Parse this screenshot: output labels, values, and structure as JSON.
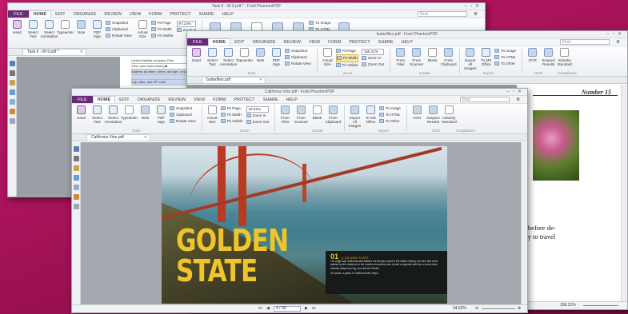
{
  "win1": {
    "title": "Task 6 - W-9.pdf * - Foxit PhantomPDF",
    "menu": [
      "FILE",
      "HOME",
      "EDIT",
      "ORGANIZE",
      "REVIEW",
      "VIEW",
      "FORM",
      "PROTECT",
      "SHARE",
      "HELP"
    ],
    "search_placeholder": "Find",
    "tools": [
      "Hand",
      "Select Text",
      "Select Annotation",
      "Typewriter",
      "Note",
      "PDF Sign",
      "Actual Size"
    ],
    "small1": [
      "SnapShot",
      "Clipboard",
      "Rotate View"
    ],
    "small2": [
      "Fit Page",
      "Fit Width",
      "Fit Visible"
    ],
    "zoom": "97.24%",
    "zoom_items": [
      "Zoom In",
      "Zoom Out"
    ],
    "small3": [
      "To Image",
      "To HTML"
    ],
    "group_tools": "Tools",
    "tab": "Task 6 - W-9.pdf *",
    "form_lines": [
      "Limited liability company. Ente",
      "Other (see instructions) ▶",
      "Address (number, street, and apt. or suite no.)",
      "City, state, and ZIP code"
    ]
  },
  "win2": {
    "title": "butterflies.pdf - Foxit PhantomPDF",
    "menu": [
      "FILE",
      "HOME",
      "EDIT",
      "ORGANIZE",
      "REVIEW",
      "VIEW",
      "FORM",
      "PROTECT",
      "SHARE",
      "HELP"
    ],
    "search_placeholder": "Find",
    "tools": [
      "Hand",
      "Select Text",
      "Select Annotation",
      "Typewriter",
      "Note",
      "PDF Sign"
    ],
    "small1": [
      "SnapShot",
      "Clipboard",
      "Rotate View"
    ],
    "actual": "Actual Size",
    "small2": [
      "Fit Page",
      "Fit Width",
      "Fit Visible"
    ],
    "zoom": "158.21%",
    "zoom_items": [
      "Zoom In",
      "Zoom Out"
    ],
    "create": [
      "From Files",
      "From Scanner",
      "Blank",
      "From Clipboard"
    ],
    "export": [
      "Export All Images",
      "To MS Office"
    ],
    "small3": [
      "To Image",
      "To HTML",
      "To Other"
    ],
    "ocr": [
      "OCR",
      "Suspect Results",
      "Industry Standard"
    ],
    "groups": [
      "Tools",
      "Zoom",
      "Create",
      "Export",
      "OCR",
      "Compliance"
    ],
    "tab": "butterflies.pdf",
    "page_heading": "Number 15",
    "page_text": [
      "apa before de-",
      "bility to travel"
    ],
    "status_zoom": "158.21%"
  },
  "win3": {
    "title": "California Vine.pdf - Foxit PhantomPDF",
    "menu": [
      "FILE",
      "HOME",
      "EDIT",
      "ORGANIZE",
      "REVIEW",
      "VIEW",
      "FORM",
      "PROTECT",
      "SHARE",
      "HELP"
    ],
    "search_placeholder": "Find",
    "tools": [
      "Hand",
      "Select Text",
      "Select Annotation",
      "Typewriter",
      "Note",
      "PDF Sign"
    ],
    "small1": [
      "SnapShot",
      "Clipboard",
      "Rotate View"
    ],
    "actual": "Actual Size",
    "small2": [
      "Fit Page",
      "Fit Width",
      "Fit Visible"
    ],
    "zoom": "34.62%",
    "zoom_items": [
      "Zoom In",
      "Zoom Out"
    ],
    "create": [
      "From Files",
      "From Scanner",
      "Blank",
      "From Clipboard"
    ],
    "export": [
      "Export All Images",
      "To MS Office"
    ],
    "small3": [
      "To Image",
      "To HTML",
      "To Other"
    ],
    "ocr": [
      "OCR",
      "Suspect Results",
      "Industry Standard"
    ],
    "groups": [
      "Tools",
      "Zoom",
      "Create",
      "Export",
      "OCR",
      "Compliance"
    ],
    "tab": "California Vine.pdf",
    "headline": [
      "GOLDEN",
      "STATE"
    ],
    "caption_num": "01",
    "caption_title": "A GOLDEN STATE",
    "caption_body": "You might say California winemakers are deeply rooted in the state's history, from the first vines planted by the missions to the modern innovators who turned a regional craft into a world-class industry shaped by fog, sun and the Pacific.",
    "caption_sub": "Of course, a glass of California wine helps.",
    "page": "4 / 30",
    "status_zoom": "34.62%"
  }
}
